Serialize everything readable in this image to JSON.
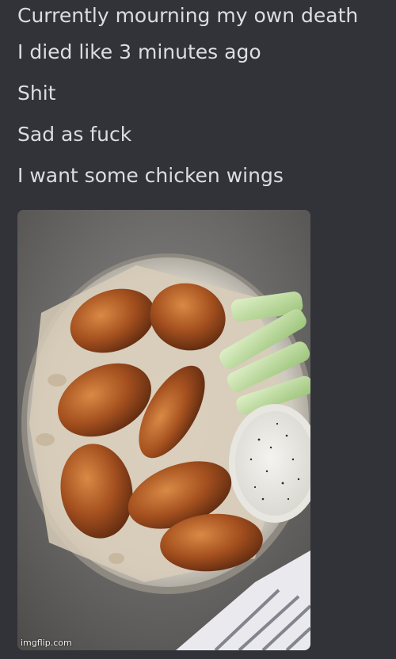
{
  "messages": [
    {
      "text": "Currently mourning my own death"
    },
    {
      "text": "I died like 3 minutes ago"
    },
    {
      "text": "Shit"
    },
    {
      "text": "Sad as fuck"
    },
    {
      "text": "I want some chicken wings"
    }
  ],
  "attachment": {
    "alt": "plate of chicken wings with celery and ranch dip"
  },
  "watermark": "imgflip.com",
  "colors": {
    "background": "#313338",
    "text": "#dbdee1"
  }
}
